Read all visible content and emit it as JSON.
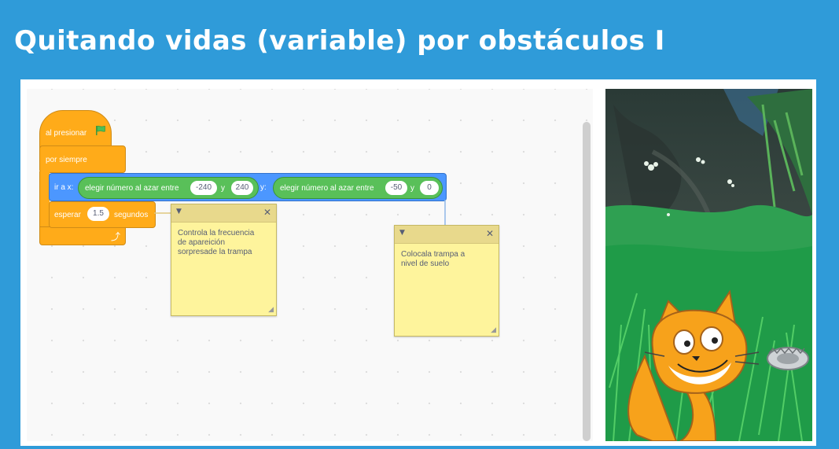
{
  "title": "Quitando vidas (variable) por  obstáculos I",
  "blocks": {
    "when_flag": "al presionar",
    "forever": "por siempre",
    "goto_label": "ir a x:",
    "random1_label": "elegir número al azar entre",
    "random1_from": "-240",
    "random1_and": "y",
    "random1_to": "240",
    "y_label": "y:",
    "random2_label": "elegir número al azar entre",
    "random2_from": "-50",
    "random2_and": "y",
    "random2_to": "0",
    "wait_label": "esperar",
    "wait_value": "1.5",
    "wait_unit": "segundos"
  },
  "notes": [
    {
      "text": "Controla la frecuencia\n de  apareición\nsorpresade la trampa"
    },
    {
      "text": "Colocala  trampa a\nnivel  de suelo"
    }
  ],
  "colors": {
    "background": "#2f9bd9",
    "events": "#ffab19",
    "motion": "#4c97ff",
    "operators": "#59c059",
    "note": "#fef49c"
  }
}
